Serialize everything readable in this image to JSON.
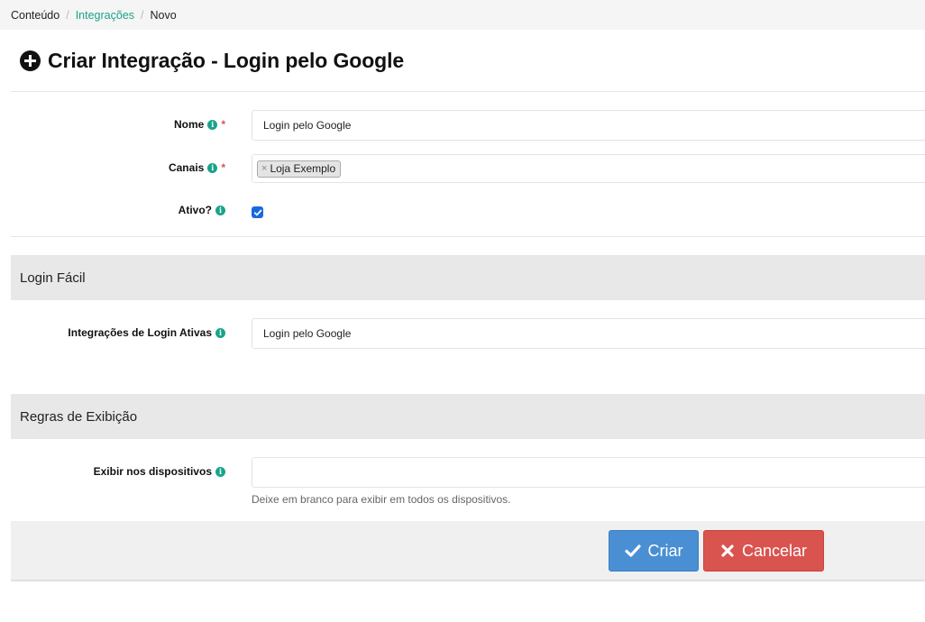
{
  "breadcrumb": {
    "items": [
      {
        "label": "Conteúdo",
        "link": false
      },
      {
        "label": "Integrações",
        "link": true
      },
      {
        "label": "Novo",
        "link": false
      }
    ]
  },
  "page": {
    "title": "Criar Integração - Login pelo Google"
  },
  "form": {
    "nome": {
      "label": "Nome",
      "value": "Login pelo Google",
      "required": "*"
    },
    "canais": {
      "label": "Canais",
      "tag": "Loja Exemplo",
      "tag_remove": "×",
      "required": "*"
    },
    "ativo": {
      "label": "Ativo?",
      "checked": true
    }
  },
  "sections": {
    "login_facil": {
      "title": "Login Fácil",
      "integracoes": {
        "label": "Integrações de Login Ativas",
        "value": "Login pelo Google"
      }
    },
    "regras": {
      "title": "Regras de Exibição",
      "dispositivos": {
        "label": "Exibir nos dispositivos",
        "value": "",
        "help": "Deixe em branco para exibir em todos os dispositivos."
      }
    }
  },
  "actions": {
    "create_label": "Criar",
    "cancel_label": "Cancelar"
  },
  "icons": {
    "info": "info-icon",
    "plus": "plus-circle-icon",
    "check": "check-icon",
    "close": "close-icon"
  },
  "colors": {
    "accent": "#1aa38a",
    "primary": "#4a8fd3",
    "danger": "#d9534f",
    "checkbox": "#1769e0"
  }
}
